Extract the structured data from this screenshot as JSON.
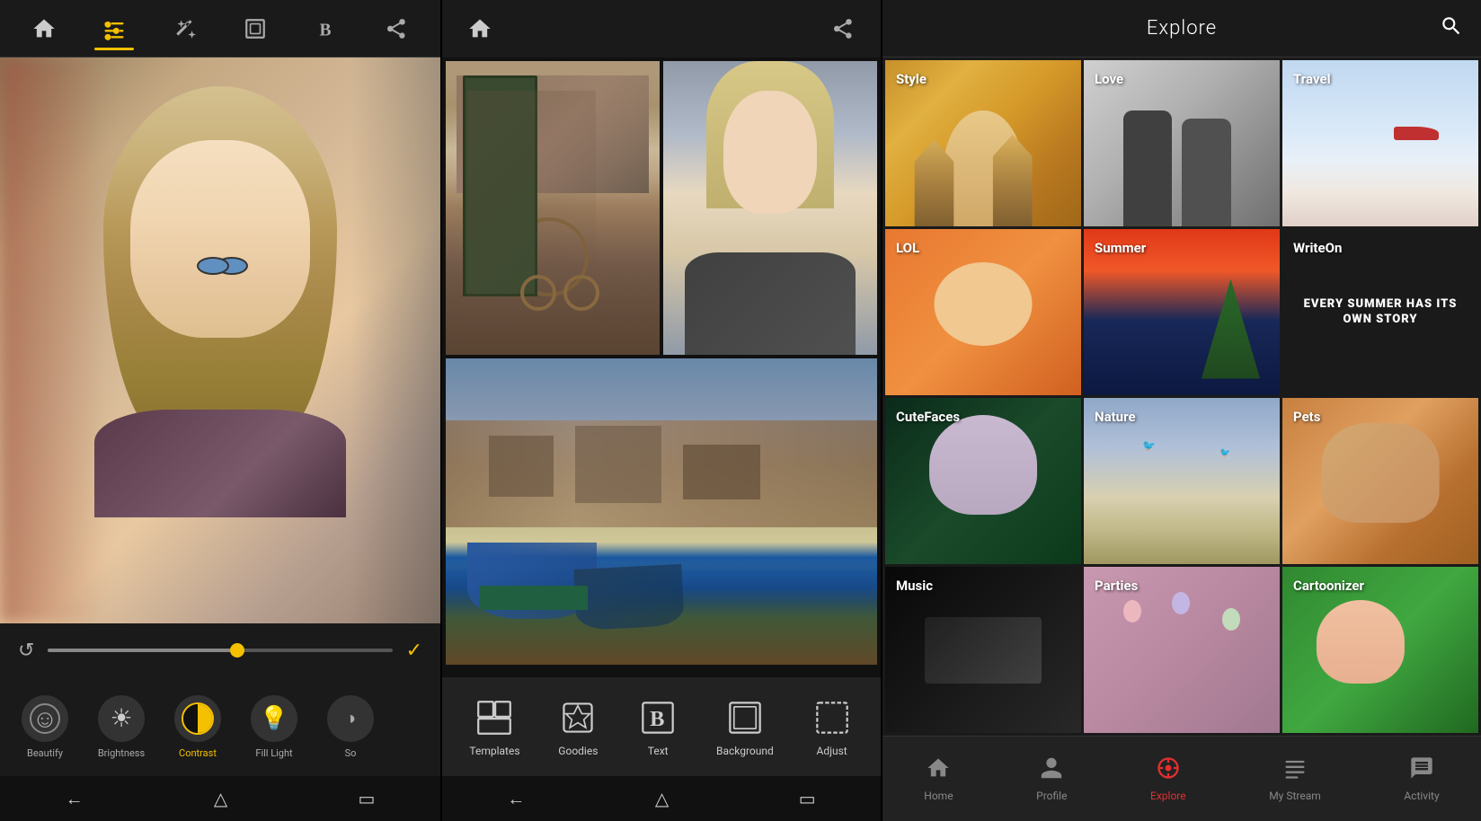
{
  "panel1": {
    "toolbar": {
      "home_icon": "home",
      "edit_icon": "edit-sliders",
      "magic_icon": "magic-wand",
      "frame_icon": "frame",
      "text_icon": "bold-b",
      "share_icon": "share"
    },
    "slider": {
      "value": 55
    },
    "tools": [
      {
        "id": "beautify",
        "label": "Beautify",
        "active": false
      },
      {
        "id": "brightness",
        "label": "Brightness",
        "active": false
      },
      {
        "id": "contrast",
        "label": "Contrast",
        "active": true
      },
      {
        "id": "fill_light",
        "label": "Fill Light",
        "active": false
      },
      {
        "id": "so",
        "label": "So",
        "active": false
      }
    ]
  },
  "panel2": {
    "tools": [
      {
        "id": "templates",
        "label": "Templates"
      },
      {
        "id": "goodies",
        "label": "Goodies"
      },
      {
        "id": "text",
        "label": "Text"
      },
      {
        "id": "background",
        "label": "Background"
      },
      {
        "id": "adjust",
        "label": "Adjust"
      }
    ]
  },
  "panel3": {
    "header": {
      "title": "Explore"
    },
    "grid": [
      {
        "id": "style",
        "label": "Style"
      },
      {
        "id": "love",
        "label": "Love"
      },
      {
        "id": "travel",
        "label": "Travel"
      },
      {
        "id": "lol",
        "label": "LOL"
      },
      {
        "id": "summer",
        "label": "Summer"
      },
      {
        "id": "writeon",
        "label": "WriteOn",
        "subtext": "EVERY SUMMER HAS ITS OWN STORY"
      },
      {
        "id": "cutefaces",
        "label": "CuteFaces"
      },
      {
        "id": "nature",
        "label": "Nature"
      },
      {
        "id": "pets",
        "label": "Pets"
      },
      {
        "id": "music",
        "label": "Music"
      },
      {
        "id": "parties",
        "label": "Parties"
      },
      {
        "id": "cartoonizer",
        "label": "Cartoonizer"
      }
    ],
    "bottom_nav": [
      {
        "id": "home",
        "label": "Home",
        "active": false
      },
      {
        "id": "profile",
        "label": "Profile",
        "active": false
      },
      {
        "id": "explore",
        "label": "Explore",
        "active": true
      },
      {
        "id": "mystream",
        "label": "My Stream",
        "active": false
      },
      {
        "id": "activity",
        "label": "Activity",
        "active": false
      }
    ]
  }
}
